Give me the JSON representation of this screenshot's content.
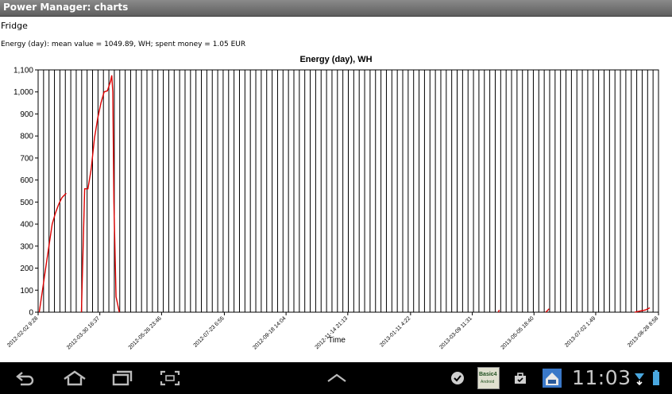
{
  "app": {
    "title": "Power Manager: charts"
  },
  "device_name": "Fridge",
  "summary": "Energy (day):  mean value = 1049.89, WH; spent money = 1.05 EUR",
  "chart_data": {
    "type": "line",
    "title": "Energy (day), WH",
    "xlabel": "Time",
    "ylabel": "",
    "ylim": [
      0,
      1100
    ],
    "y_ticks": [
      0,
      100,
      200,
      300,
      400,
      500,
      600,
      700,
      800,
      900,
      1000,
      1100
    ],
    "y_tick_labels": [
      "0",
      "100",
      "200",
      "300",
      "400",
      "500",
      "600",
      "700",
      "800",
      "900",
      "1,000",
      "1,100"
    ],
    "x_range_days": [
      0,
      573
    ],
    "x_ticks": [
      {
        "day": 0,
        "label": "2012-02-02 9:28"
      },
      {
        "day": 57,
        "label": "2012-03-30 16:37"
      },
      {
        "day": 114,
        "label": "2012-05-26 23:46"
      },
      {
        "day": 172,
        "label": "2012-07-23 6:55"
      },
      {
        "day": 229,
        "label": "2012-09-18 14:04"
      },
      {
        "day": 286,
        "label": "2012-11-14 21:13"
      },
      {
        "day": 344,
        "label": "2013-01-11 4:22"
      },
      {
        "day": 401,
        "label": "2013-03-09 11:31"
      },
      {
        "day": 458,
        "label": "2013-05-05 18:40"
      },
      {
        "day": 515,
        "label": "2013-07-02 1:49"
      },
      {
        "day": 573,
        "label": "2013-08-28 8:58"
      }
    ],
    "grid": true,
    "grid_lines": 114,
    "series": [
      {
        "name": "",
        "color": "#dd0000",
        "segments": [
          [
            [
              1,
              0
            ],
            [
              4,
              100
            ],
            [
              7,
              200
            ],
            [
              10,
              300
            ],
            [
              13,
              400
            ],
            [
              16,
              450
            ],
            [
              19,
              490
            ],
            [
              22,
              520
            ],
            [
              26,
              540
            ]
          ],
          [
            [
              40,
              0
            ],
            [
              43,
              560
            ],
            [
              46,
              560
            ],
            [
              49,
              650
            ],
            [
              52,
              790
            ],
            [
              55,
              880
            ],
            [
              58,
              950
            ],
            [
              61,
              1000
            ],
            [
              64,
              1005
            ],
            [
              67,
              1050
            ],
            [
              68,
              1075
            ],
            [
              69,
              1000
            ],
            [
              70,
              500
            ],
            [
              72,
              70
            ],
            [
              75,
              0
            ]
          ],
          [
            [
              425,
              0
            ],
            [
              426,
              10
            ]
          ],
          [
            [
              469,
              0
            ],
            [
              472,
              15
            ]
          ],
          [
            [
              551,
              0
            ],
            [
              556,
              5
            ],
            [
              561,
              10
            ],
            [
              565,
              20
            ]
          ]
        ]
      }
    ]
  },
  "statusbar": {
    "time": "11:03",
    "icons": [
      "check-circle-icon",
      "basic4android-icon",
      "briefcase-icon",
      "home-app-icon",
      "wifi-download-icon",
      "battery-icon"
    ],
    "nav_icons": [
      "back-icon",
      "home-icon",
      "recents-icon",
      "screenshot-icon",
      "up-arrow-icon"
    ],
    "basic_label": "Basic4",
    "basic_sub": "Android"
  }
}
